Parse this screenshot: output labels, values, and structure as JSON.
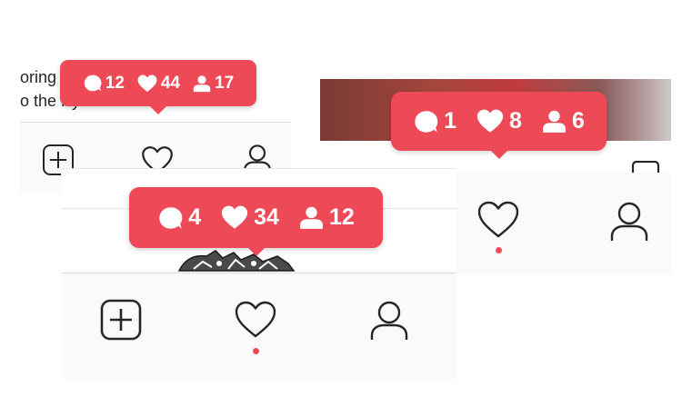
{
  "colors": {
    "accent": "#ed4956",
    "tabbar_bg": "#fafafa",
    "icon_stroke": "#262626",
    "divider": "#dbdbdb"
  },
  "panel_small": {
    "caption_line_1": "oring",
    "caption_line_2": "o the Pyramids of Giza",
    "bubble": {
      "comments": "12",
      "likes": "44",
      "followers": "17"
    },
    "tabs": [
      {
        "icon": "add-post-icon"
      },
      {
        "icon": "heart-icon"
      },
      {
        "icon": "profile-icon"
      }
    ]
  },
  "panel_right": {
    "bubble": {
      "comments": "1",
      "likes": "8",
      "followers": "6"
    },
    "tabs": [
      {
        "icon": "heart-icon",
        "has_notification_dot": true
      },
      {
        "icon": "profile-icon"
      }
    ]
  },
  "panel_large": {
    "bubble": {
      "comments": "4",
      "likes": "34",
      "followers": "12"
    },
    "tabs": [
      {
        "icon": "add-post-icon"
      },
      {
        "icon": "heart-icon",
        "has_notification_dot": true
      },
      {
        "icon": "profile-icon"
      }
    ]
  }
}
